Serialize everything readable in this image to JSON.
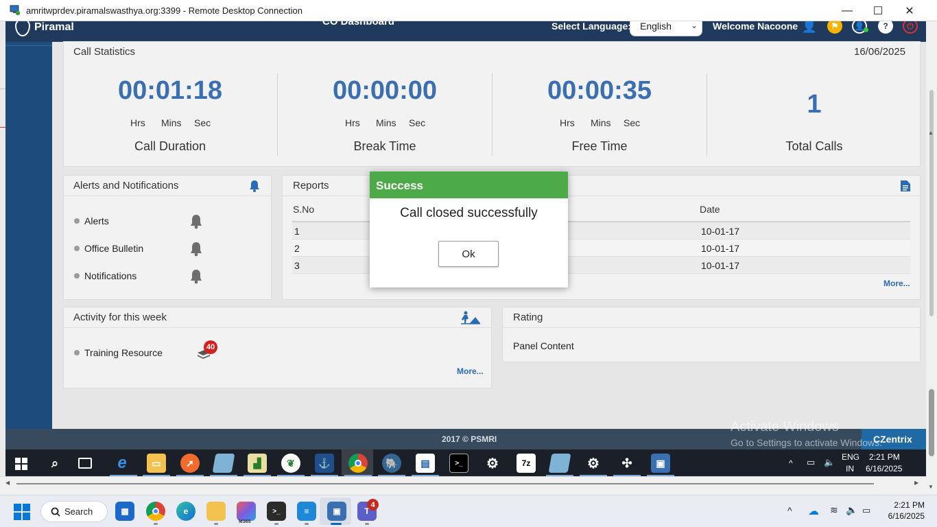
{
  "rdp": {
    "title": "amritwprdev.piramalswasthya.org:3399 - Remote Desktop Connection",
    "minimize": "—",
    "maximize": "☐",
    "close": "✕"
  },
  "app": {
    "logo_text": "Piramal",
    "dashboard_title": "CO Dashboard",
    "select_language_label": "Select Language:",
    "language_value": "English",
    "welcome": "Welcome Nacoone",
    "colors": {
      "header": "#1f3a5c",
      "sidebar": "#1d4c7c",
      "accent_blue": "#3a6fb1",
      "success_green": "#4caa48"
    }
  },
  "stats": {
    "title": "Call Statistics",
    "date": "16/06/2025",
    "items": [
      {
        "value": "00:01:18",
        "units": [
          "Hrs",
          "Mins",
          "Sec"
        ],
        "caption": "Call Duration"
      },
      {
        "value": "00:00:00",
        "units": [
          "Hrs",
          "Mins",
          "Sec"
        ],
        "caption": "Break Time"
      },
      {
        "value": "00:00:35",
        "units": [
          "Hrs",
          "Mins",
          "Sec"
        ],
        "caption": "Free Time"
      },
      {
        "value": "1",
        "caption": "Total Calls"
      }
    ]
  },
  "alerts": {
    "title": "Alerts and Notifications",
    "items": [
      "Alerts",
      "Office Bulletin",
      "Notifications"
    ]
  },
  "reports": {
    "title": "Reports",
    "headers": [
      "S.No",
      "Date"
    ],
    "rows": [
      {
        "sno": "1",
        "date": "10-01-17"
      },
      {
        "sno": "2",
        "date": "10-01-17"
      },
      {
        "sno": "3",
        "date": "10-01-17"
      }
    ],
    "more": "More..."
  },
  "activity": {
    "title": "Activity for this week",
    "items": [
      {
        "label": "Training Resource",
        "badge": "40"
      }
    ],
    "more": "More..."
  },
  "rating": {
    "title": "Rating",
    "content": "Panel Content"
  },
  "footer": {
    "copyright": "2017 © PSMRI",
    "brand": "CZentrix"
  },
  "modal": {
    "title": "Success",
    "message": "Call closed successfully",
    "ok": "Ok"
  },
  "remote_taskbar": {
    "activate_title": "Activate Windows",
    "activate_sub": "Go to Settings to activate Windows.",
    "lang_top": "ENG",
    "lang_bottom": "IN",
    "time": "2:21 PM",
    "date": "6/16/2025"
  },
  "host_taskbar": {
    "search": "Search",
    "teams_badge": "4",
    "m365_label": "M365",
    "time": "2:21 PM",
    "date": "6/16/2025"
  }
}
